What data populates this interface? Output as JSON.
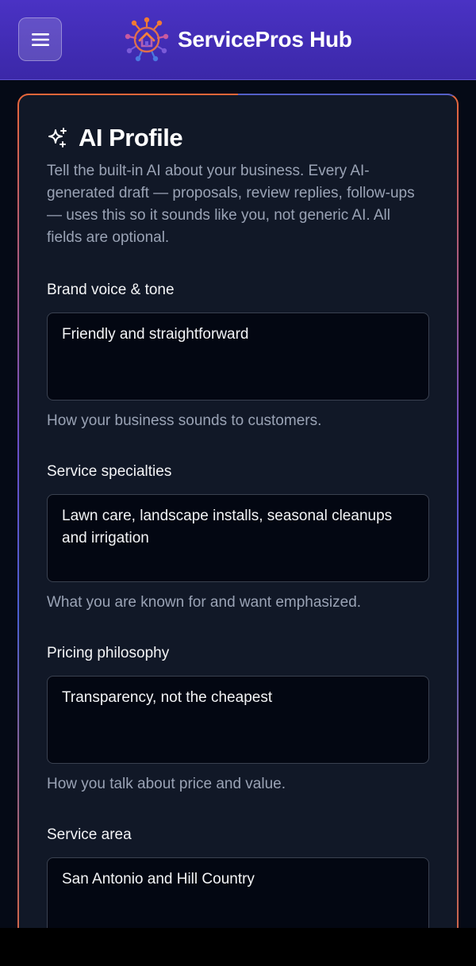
{
  "header": {
    "brand_name": "ServicePros Hub",
    "logo_icon": "house-network-logo",
    "menu_icon": "hamburger-menu-icon"
  },
  "colors": {
    "header_start": "#4a32c4",
    "header_end": "#3b28a8",
    "card_bg": "#111827",
    "accent_orange": "#e8663a",
    "accent_blue": "#4b5fd0"
  },
  "profile": {
    "title": "AI Profile",
    "title_icon": "sparkles-icon",
    "intro": "Tell the built-in AI about your business. Every AI-generated draft — proposals, review replies, follow-ups — uses this so it sounds like you, not generic AI. All fields are optional.",
    "fields": [
      {
        "label": "Brand voice & tone",
        "value": "Friendly and straightforward",
        "help": "How your business sounds to customers."
      },
      {
        "label": "Service specialties",
        "value": "Lawn care, landscape installs, seasonal cleanups and irrigation",
        "help": "What you are known for and want emphasized."
      },
      {
        "label": "Pricing philosophy",
        "value": "Transparency, not the cheapest",
        "help": "How you talk about price and value."
      },
      {
        "label": "Service area",
        "value": "San Antonio and Hill Country",
        "help": ""
      }
    ]
  }
}
